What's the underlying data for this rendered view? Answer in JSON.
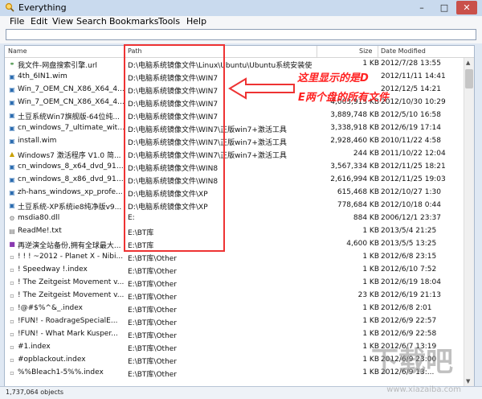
{
  "window": {
    "title": "Everything"
  },
  "menu": [
    "File",
    "Edit",
    "View",
    "Search",
    "Bookmarks",
    "Tools",
    "Help"
  ],
  "search": {
    "value": ""
  },
  "columns": {
    "name": "Name",
    "path": "Path",
    "size": "Size",
    "date": "Date Modified"
  },
  "rows": [
    {
      "icon": "url-file-icon",
      "name": "我文件-网盘搜索引擎.url",
      "path": "D:\\电脑系统镜像文件\\Linux\\Ubuntu\\Ubuntu系统安装使...",
      "size": "1 KB",
      "date": "2012/7/28 13:55"
    },
    {
      "icon": "disk-image-icon",
      "name": "4th_6IN1.wim",
      "path": "D:\\电脑系统镜像文件\\WIN7",
      "size": "",
      "date": "2012/11/11 14:41"
    },
    {
      "icon": "disk-image-icon",
      "name": "Win_7_OEM_CN_X86_X64_4...",
      "path": "D:\\电脑系统镜像文件\\WIN7",
      "size": "",
      "date": "2012/12/5 14:21"
    },
    {
      "icon": "disk-image-icon",
      "name": "Win_7_OEM_CN_X86_X64_4...",
      "path": "D:\\电脑系统镜像文件\\WIN7",
      "size": "4,003,915 KB",
      "date": "2012/10/30 10:29"
    },
    {
      "icon": "disk-image-icon",
      "name": "土豆系统Win7旗舰版-64位纯...",
      "path": "D:\\电脑系统镜像文件\\WIN7",
      "size": "3,889,748 KB",
      "date": "2012/5/10 16:58"
    },
    {
      "icon": "disk-image-icon",
      "name": "cn_windows_7_ultimate_with...",
      "path": "D:\\电脑系统镜像文件\\WIN7\\正版win7+激活工具",
      "size": "3,338,918 KB",
      "date": "2012/6/19 17:14"
    },
    {
      "icon": "disk-image-icon",
      "name": "install.wim",
      "path": "D:\\电脑系统镜像文件\\WIN7\\正版win7+激活工具",
      "size": "2,928,460 KB",
      "date": "2010/11/22 4:58"
    },
    {
      "icon": "exe-file-icon",
      "name": "Windows7 激活程序 V1.0 简...",
      "path": "D:\\电脑系统镜像文件\\WIN7\\正版win7+激活工具",
      "size": "244 KB",
      "date": "2011/10/22 12:04"
    },
    {
      "icon": "disk-image-icon",
      "name": "cn_windows_8_x64_dvd_915...",
      "path": "D:\\电脑系统镜像文件\\WIN8",
      "size": "3,567,334 KB",
      "date": "2012/11/25 18:21"
    },
    {
      "icon": "disk-image-icon",
      "name": "cn_windows_8_x86_dvd_915...",
      "path": "D:\\电脑系统镜像文件\\WIN8",
      "size": "2,616,994 KB",
      "date": "2012/11/25 19:03"
    },
    {
      "icon": "disk-image-icon",
      "name": "zh-hans_windows_xp_profe...",
      "path": "D:\\电脑系统镜像文件\\XP",
      "size": "615,468 KB",
      "date": "2012/10/27 1:30"
    },
    {
      "icon": "disk-image-icon",
      "name": "土豆系统-XP系统ie8纯净版v9...",
      "path": "D:\\电脑系统镜像文件\\XP",
      "size": "778,684 KB",
      "date": "2012/10/18 0:44"
    },
    {
      "icon": "dll-file-icon",
      "name": "msdia80.dll",
      "path": "E:",
      "size": "884 KB",
      "date": "2006/12/1 23:37"
    },
    {
      "icon": "text-file-icon",
      "name": "ReadMe!.txt",
      "path": "E:\\BT库",
      "size": "1 KB",
      "date": "2013/5/4 21:25"
    },
    {
      "icon": "archive-file-icon",
      "name": "再逆演全站备份,拥有全球最大...",
      "path": "E:\\BT库",
      "size": "4,600 KB",
      "date": "2013/5/5 13:25"
    },
    {
      "icon": "index-file-icon",
      "name": "! ! ! ~2012 - Planet X - Nibi...",
      "path": "E:\\BT库\\Other",
      "size": "1 KB",
      "date": "2012/6/8 23:15"
    },
    {
      "icon": "index-file-icon",
      "name": "! Speedway !.index",
      "path": "E:\\BT库\\Other",
      "size": "1 KB",
      "date": "2012/6/10 7:52"
    },
    {
      "icon": "index-file-icon",
      "name": "! The Zeitgeist Movement v...",
      "path": "E:\\BT库\\Other",
      "size": "1 KB",
      "date": "2012/6/19 18:04"
    },
    {
      "icon": "index-file-icon",
      "name": "! The Zeitgeist Movement v...",
      "path": "E:\\BT库\\Other",
      "size": "23 KB",
      "date": "2012/6/19 21:13"
    },
    {
      "icon": "index-file-icon",
      "name": "!@#$%^&_.index",
      "path": "E:\\BT库\\Other",
      "size": "1 KB",
      "date": "2012/6/8 2:01"
    },
    {
      "icon": "index-file-icon",
      "name": "!FUN! - RoadrageSpecialE...",
      "path": "E:\\BT库\\Other",
      "size": "1 KB",
      "date": "2012/6/9 22:57"
    },
    {
      "icon": "index-file-icon",
      "name": "!FUN! - What Mark Kusper...",
      "path": "E:\\BT库\\Other",
      "size": "1 KB",
      "date": "2012/6/9 22:58"
    },
    {
      "icon": "index-file-icon",
      "name": "#1.index",
      "path": "E:\\BT库\\Other",
      "size": "1 KB",
      "date": "2012/6/7 13:19"
    },
    {
      "icon": "index-file-icon",
      "name": "#opblackout.index",
      "path": "E:\\BT库\\Other",
      "size": "1 KB",
      "date": "2012/6/9 23:00"
    },
    {
      "icon": "index-file-icon",
      "name": "%%Bleach1-5%%.index",
      "path": "E:\\BT库\\Other",
      "size": "1 KB",
      "date": "2012/6/9 13:..."
    }
  ],
  "status": {
    "count": "1,737,064 objects"
  },
  "annotation": {
    "line1": "这里显示的是D",
    "line2": "E两个盘的所有文件",
    "color": "#ff2222"
  },
  "watermark": {
    "text": "下载吧",
    "url": "www.xiazaiba.com"
  }
}
